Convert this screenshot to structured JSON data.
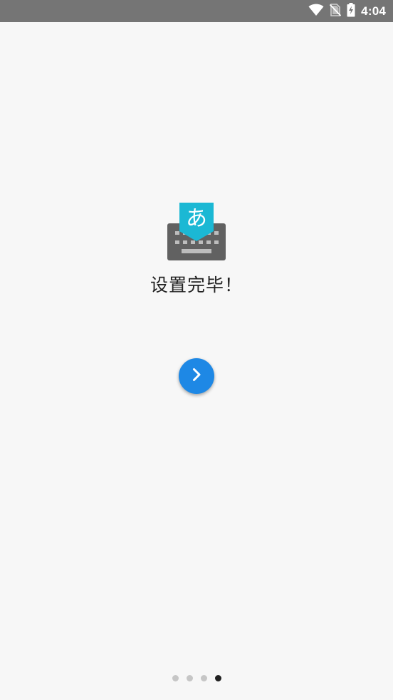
{
  "status_bar": {
    "time": "4:04",
    "icons": [
      "wifi-icon",
      "no-sim-icon",
      "battery-charging-icon"
    ]
  },
  "logo": {
    "icon": "japanese-ime-keyboard-icon",
    "glyph": "あ",
    "colors": {
      "bubble": "#1bb8d4",
      "keyboard": "#616161",
      "keys": "#bdbdbd"
    }
  },
  "title": "设置完毕！",
  "next_button": {
    "icon": "chevron-right-icon",
    "color": "#1e88e5"
  },
  "pager": {
    "total": 4,
    "current": 4
  }
}
